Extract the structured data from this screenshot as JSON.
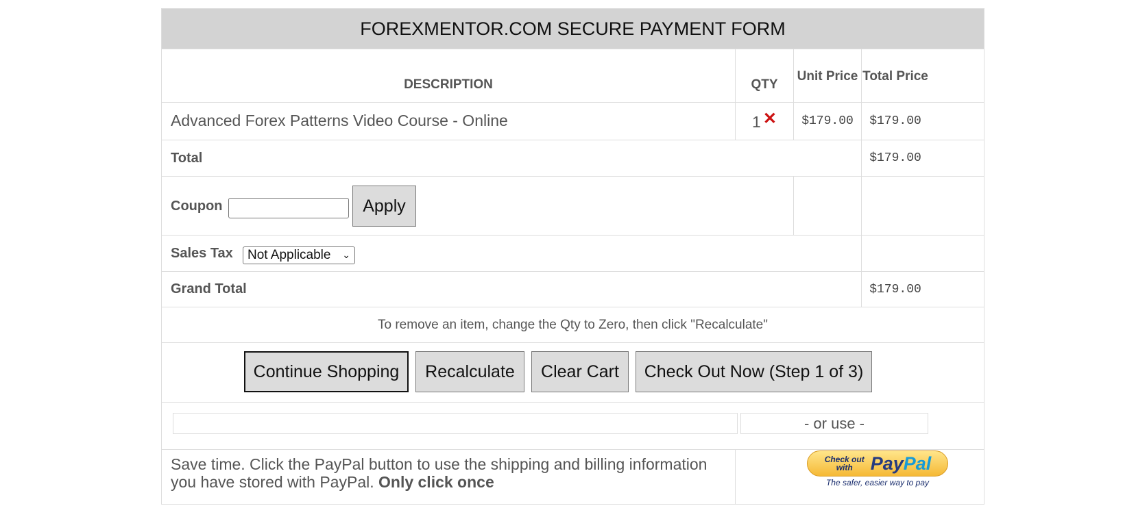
{
  "header": {
    "title": "FOREXMENTOR.COM SECURE PAYMENT FORM"
  },
  "columns": {
    "description": "DESCRIPTION",
    "qty": "QTY",
    "unit_price": "Unit Price",
    "total_price": "Total Price"
  },
  "item": {
    "description": "Advanced Forex Patterns Video Course - Online",
    "qty": "1",
    "unit_price": "$179.00",
    "total_price": "$179.00"
  },
  "total": {
    "label": "Total",
    "value": "$179.00"
  },
  "coupon": {
    "label": "Coupon",
    "value": "",
    "apply_label": "Apply"
  },
  "sales_tax": {
    "label": "Sales Tax",
    "selected": "Not Applicable"
  },
  "grand_total": {
    "label": "Grand Total",
    "value": "$179.00"
  },
  "note": "To remove an item, change the Qty to Zero, then click \"Recalculate\"",
  "buttons": {
    "continue": "Continue Shopping",
    "recalculate": "Recalculate",
    "clear": "Clear Cart",
    "checkout": "Check Out Now (Step 1 of 3)"
  },
  "or_use": "- or use -",
  "paypal_text": {
    "prefix": "Save time. Click the PayPal button to use the shipping and billing information you have stored with PayPal. ",
    "bold": "Only click once"
  },
  "paypal_button": {
    "small": "Check out with",
    "brand_a": "Pay",
    "brand_b": "Pal",
    "tagline": "The safer, easier way to pay"
  },
  "colors": {
    "header_bg": "#d3d3d3",
    "button_bg": "#dcdcdc",
    "remove_icon": "#cc1111",
    "border": "#dddddd"
  },
  "icons": {
    "remove": "close-icon",
    "dropdown": "chevron-down-icon"
  }
}
